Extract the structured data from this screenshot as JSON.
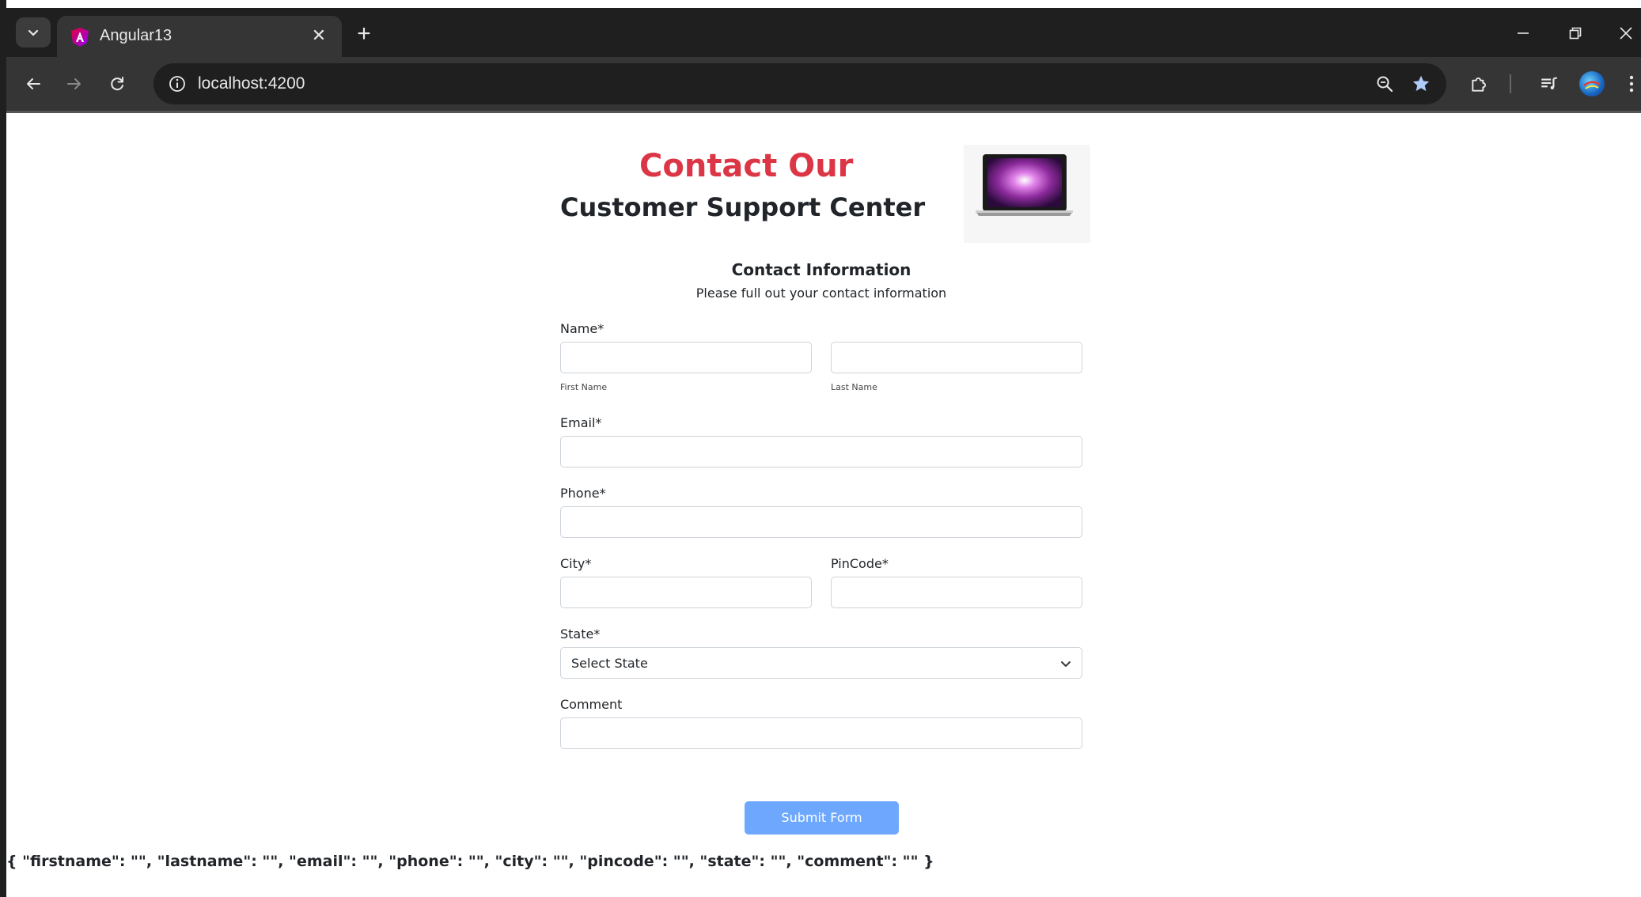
{
  "browser": {
    "tab_title": "Angular13",
    "url": "localhost:4200"
  },
  "page": {
    "heading_main": "Contact Our",
    "heading_sub": "Customer Support Center",
    "section_title": "Contact Information",
    "section_subtitle": "Please full out your contact information",
    "form": {
      "name_label": "Name*",
      "first_name_hint": "First Name",
      "last_name_hint": "Last Name",
      "first_name_value": "",
      "last_name_value": "",
      "email_label": "Email*",
      "email_value": "",
      "phone_label": "Phone*",
      "phone_value": "",
      "city_label": "City*",
      "city_value": "",
      "pincode_label": "PinCode*",
      "pincode_value": "",
      "state_label": "State*",
      "state_selected": "Select State",
      "comment_label": "Comment",
      "comment_value": "",
      "submit_label": "Submit Form"
    },
    "json_output": "{ \"firstname\": \"\", \"lastname\": \"\", \"email\": \"\", \"phone\": \"\", \"city\": \"\", \"pincode\": \"\", \"state\": \"\", \"comment\": \"\" }"
  },
  "colors": {
    "accent_red": "#dc3545",
    "button_blue": "#6ea8fe"
  }
}
